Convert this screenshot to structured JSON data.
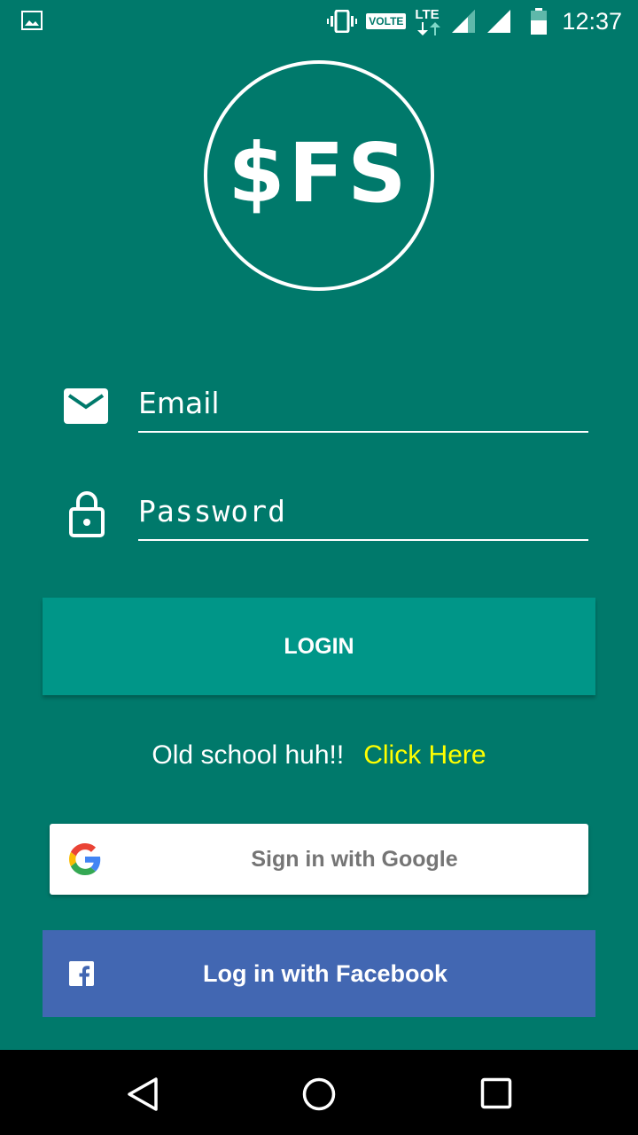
{
  "status_bar": {
    "volte": "VOLTE",
    "lte": "LTE",
    "time": "12:37"
  },
  "logo": {
    "text": "$FS"
  },
  "form": {
    "email_placeholder": "Email",
    "password_placeholder": "Password",
    "login_label": "LOGIN"
  },
  "alt_login": {
    "prefix": "Old school huh!!",
    "link": "Click Here"
  },
  "social": {
    "google_label": "Sign in with Google",
    "facebook_label": "Log in with Facebook"
  },
  "colors": {
    "background": "#00796b",
    "login_button": "#009688",
    "link": "#ffff00",
    "facebook": "#4267b2"
  },
  "icons": [
    "gallery-icon",
    "vibrate-icon",
    "signal-icon",
    "battery-icon",
    "email-icon",
    "lock-icon",
    "google-icon",
    "facebook-icon",
    "back-icon",
    "home-icon",
    "recents-icon"
  ]
}
